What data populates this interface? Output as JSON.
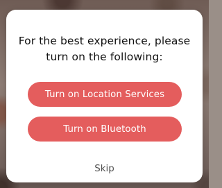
{
  "dialog": {
    "title_line_1": "For the best experience, please",
    "title_line_2": "turn on the following:",
    "buttons": {
      "location": "Turn on Location Services",
      "bluetooth": "Turn on Bluetooth"
    },
    "skip_label": "Skip"
  },
  "colors": {
    "button_background": "#e45d5d",
    "button_text": "#ffffff",
    "title_text": "#111111",
    "skip_text": "#505050"
  }
}
